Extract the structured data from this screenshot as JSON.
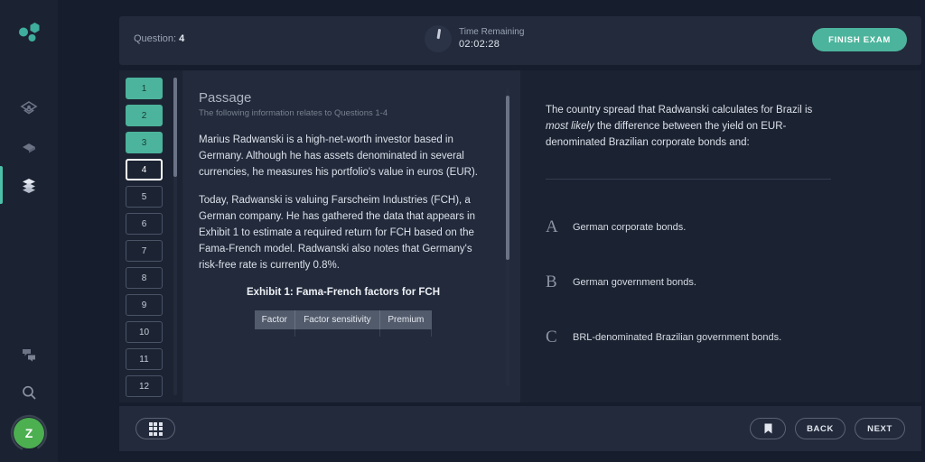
{
  "app": {
    "logo_name": "molecule-logo",
    "accent": "#4cb49c",
    "background": "#161d2c",
    "panel": "#222a3b"
  },
  "rail": {
    "items": [
      {
        "name": "dashboard-icon",
        "label": "Dashboard",
        "active": false
      },
      {
        "name": "bookmark-layers-icon",
        "label": "Study",
        "active": false
      },
      {
        "name": "stack-layers-icon",
        "label": "Practice",
        "active": true
      }
    ],
    "bottom_items": [
      {
        "name": "chat-icon",
        "label": "Messages"
      },
      {
        "name": "search-icon",
        "label": "Search"
      }
    ],
    "avatar": {
      "initial": "Z",
      "color": "#4caf50"
    }
  },
  "header": {
    "question_prefix": "Question:",
    "question_number": "4",
    "timer_label": "Time Remaining",
    "timer_value": "02:02:28",
    "finish_label": "FINISH EXAM"
  },
  "qnav": {
    "items": [
      {
        "number": "1",
        "state": "done"
      },
      {
        "number": "2",
        "state": "done"
      },
      {
        "number": "3",
        "state": "done"
      },
      {
        "number": "4",
        "state": "current"
      },
      {
        "number": "5",
        "state": "unanswered"
      },
      {
        "number": "6",
        "state": "unanswered"
      },
      {
        "number": "7",
        "state": "unanswered"
      },
      {
        "number": "8",
        "state": "unanswered"
      },
      {
        "number": "9",
        "state": "unanswered"
      },
      {
        "number": "10",
        "state": "unanswered"
      },
      {
        "number": "11",
        "state": "unanswered"
      },
      {
        "number": "12",
        "state": "unanswered"
      }
    ]
  },
  "passage": {
    "title": "Passage",
    "subtitle": "The following information relates to Questions 1-4",
    "paragraphs": [
      "Marius Radwanski is a high-net-worth investor based in Germany. Although he has assets denominated in several currencies, he measures his portfolio's value in euros (EUR).",
      "Today, Radwanski is valuing Farscheim Industries (FCH), a German company. He has gathered the data that appears in Exhibit 1 to estimate a required return for FCH based on the Fama-French model. Radwanski also notes that Germany's risk-free rate is currently 0.8%."
    ],
    "exhibit_title": "Exhibit 1: Fama-French factors for FCH",
    "exhibit_columns": [
      "Factor",
      "Factor sensitivity",
      "Premium"
    ]
  },
  "question": {
    "stem_part1": "The country spread that Radwanski calculates for Brazil is ",
    "stem_emphasis": "most likely",
    "stem_part2": " the difference between the yield on EUR-denominated Brazilian corporate bonds and:",
    "choices": [
      {
        "letter": "A",
        "text": "German corporate bonds."
      },
      {
        "letter": "B",
        "text": "German government bonds."
      },
      {
        "letter": "C",
        "text": "BRL-denominated Brazilian government bonds."
      }
    ]
  },
  "footer": {
    "grid_name": "question-grid-icon",
    "flag_name": "bookmark-icon",
    "back_label": "BACK",
    "next_label": "NEXT"
  }
}
